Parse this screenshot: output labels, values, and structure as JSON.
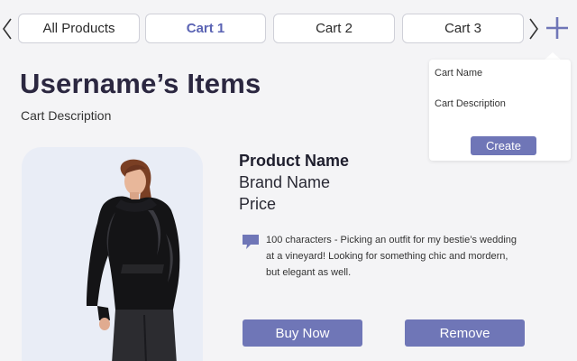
{
  "tabs": [
    {
      "label": "All Products",
      "active": false
    },
    {
      "label": "Cart 1",
      "active": true
    },
    {
      "label": "Cart 2",
      "active": false
    },
    {
      "label": "Cart 3",
      "active": false
    }
  ],
  "icons": {
    "prev": "chevron-left-icon",
    "next": "chevron-right-icon",
    "add": "plus-icon",
    "note": "speech-bubble-icon"
  },
  "popover": {
    "name_placeholder": "Cart Name",
    "description_placeholder": "Cart Description",
    "create_label": "Create"
  },
  "header": {
    "title": "Username’s Items",
    "description": "Cart Description"
  },
  "product": {
    "name": "Product Name",
    "brand": "Brand Name",
    "price": "Price",
    "note": "100 characters -  Picking an outfit for my bestie’s wedding at a vineyard! Looking for something chic and mordern, but elegant as well.",
    "buy_label": "Buy Now",
    "remove_label": "Remove"
  },
  "colors": {
    "accent": "#6f76b7",
    "active_tab_text": "#5b64b4",
    "background": "#f4f4f6",
    "card_background": "#e9edf6"
  }
}
